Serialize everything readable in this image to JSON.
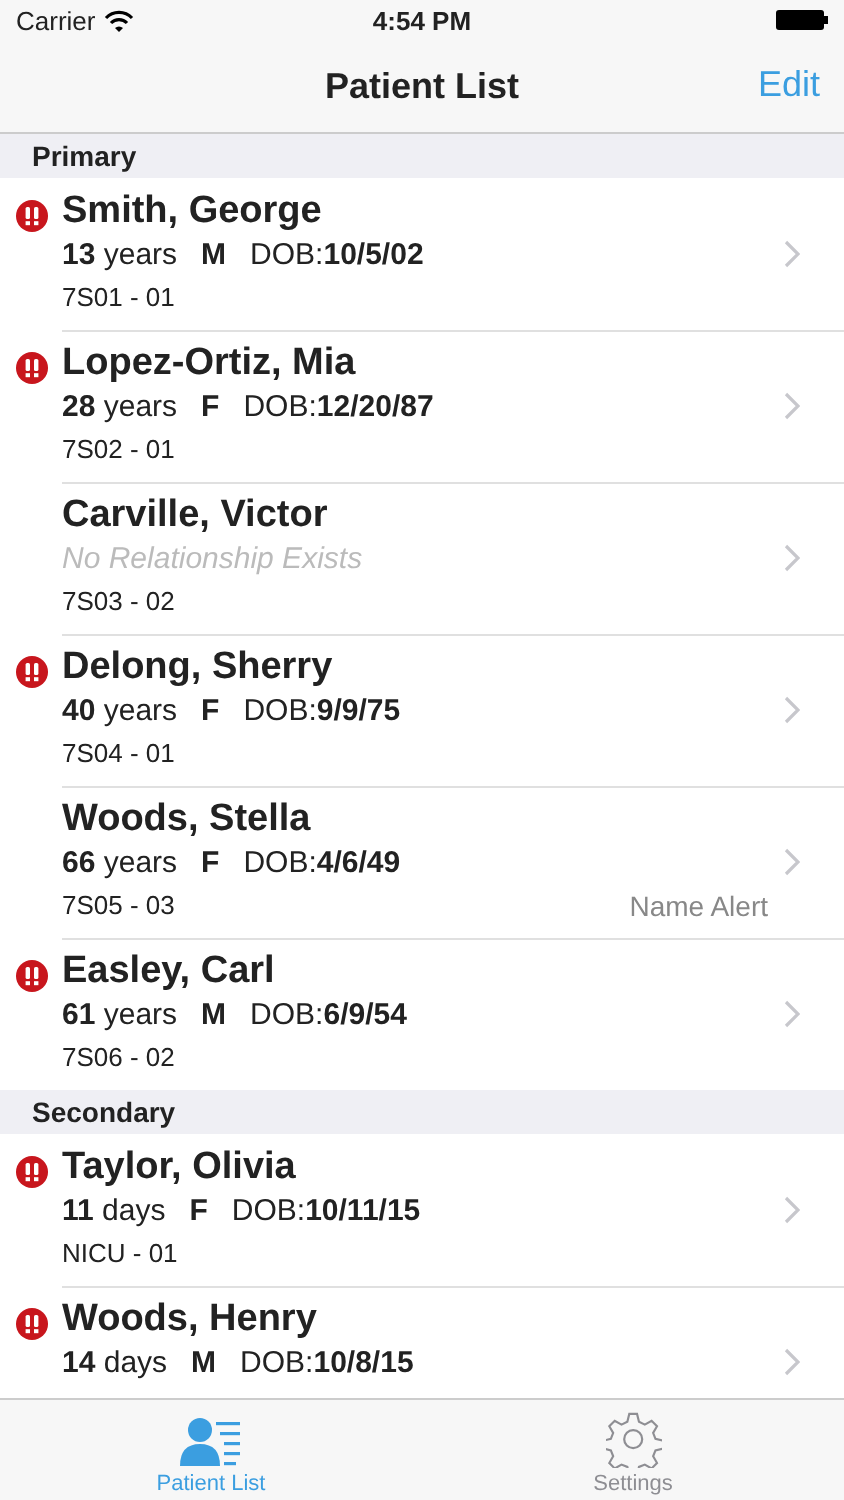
{
  "status_bar": {
    "carrier": "Carrier",
    "time": "4:54 PM"
  },
  "nav_bar": {
    "title": "Patient List",
    "action": "Edit"
  },
  "sections": [
    {
      "title": "Primary",
      "rows": [
        {
          "kind": "details",
          "alert": true,
          "name": "Smith, George",
          "age": "13",
          "age_unit": "years",
          "sex": "M",
          "dob_label": "DOB:",
          "dob": "10/5/02",
          "unit": "7S01 - 01"
        },
        {
          "kind": "details",
          "alert": true,
          "name": "Lopez-Ortiz, Mia",
          "age": "28",
          "age_unit": "years",
          "sex": "F",
          "dob_label": "DOB:",
          "dob": "12/20/87",
          "unit": "7S02 - 01"
        },
        {
          "kind": "no-relationship",
          "alert": false,
          "name": "Carville, Victor",
          "message": "No Relationship Exists",
          "unit": "7S03 - 02"
        },
        {
          "kind": "details",
          "alert": true,
          "name": "Delong, Sherry",
          "age": "40",
          "age_unit": "years",
          "sex": "F",
          "dob_label": "DOB:",
          "dob": "9/9/75",
          "unit": "7S04 - 01"
        },
        {
          "kind": "details",
          "alert": false,
          "name": "Woods, Stella",
          "age": "66",
          "age_unit": "years",
          "sex": "F",
          "dob_label": "DOB:",
          "dob": "4/6/49",
          "unit": "7S05 - 03",
          "note": "Name Alert"
        },
        {
          "kind": "details",
          "alert": true,
          "name": "Easley, Carl",
          "age": "61",
          "age_unit": "years",
          "sex": "M",
          "dob_label": "DOB:",
          "dob": "6/9/54",
          "unit": "7S06 - 02"
        }
      ]
    },
    {
      "title": "Secondary",
      "rows": [
        {
          "kind": "details",
          "alert": true,
          "name": "Taylor, Olivia",
          "age": "11",
          "age_unit": "days",
          "sex": "F",
          "dob_label": "DOB:",
          "dob": "10/11/15",
          "unit": "NICU - 01"
        },
        {
          "kind": "details",
          "alert": true,
          "name": "Woods, Henry",
          "age": "14",
          "age_unit": "days",
          "sex": "M",
          "dob_label": "DOB:",
          "dob": "10/8/15"
        }
      ]
    }
  ],
  "tab_bar": [
    {
      "label": "Patient List",
      "selected": true
    },
    {
      "label": "Settings",
      "selected": false
    }
  ]
}
